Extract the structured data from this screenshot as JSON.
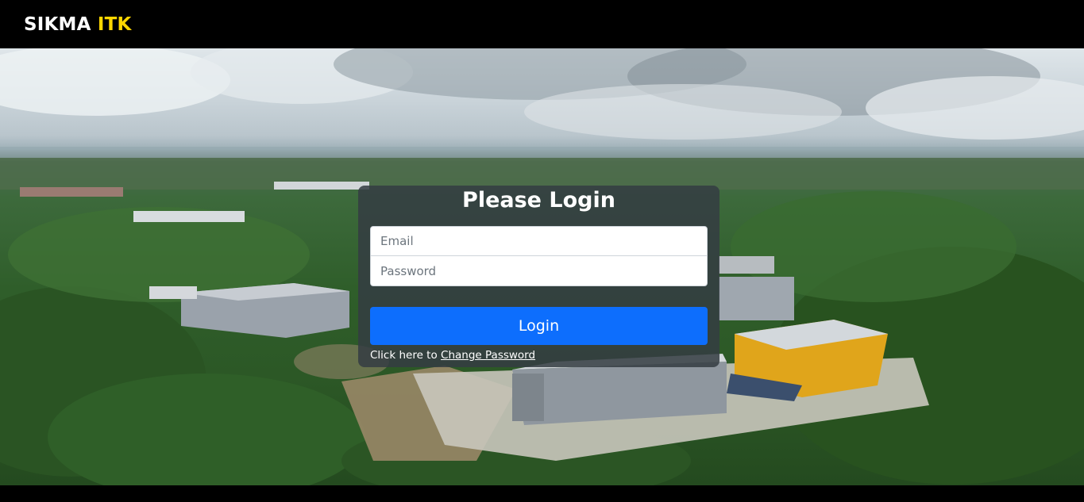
{
  "navbar": {
    "brand_part1": "SIKMA",
    "brand_part2": "ITK"
  },
  "login": {
    "title": "Please Login",
    "email_placeholder": "Email",
    "password_placeholder": "Password",
    "button_label": "Login",
    "helper_prefix": "Click here to",
    "change_password_link": "Change Password"
  },
  "colors": {
    "navbar_bg": "#000000",
    "brand_accent": "#ffd700",
    "button_primary": "#0d6efd"
  }
}
